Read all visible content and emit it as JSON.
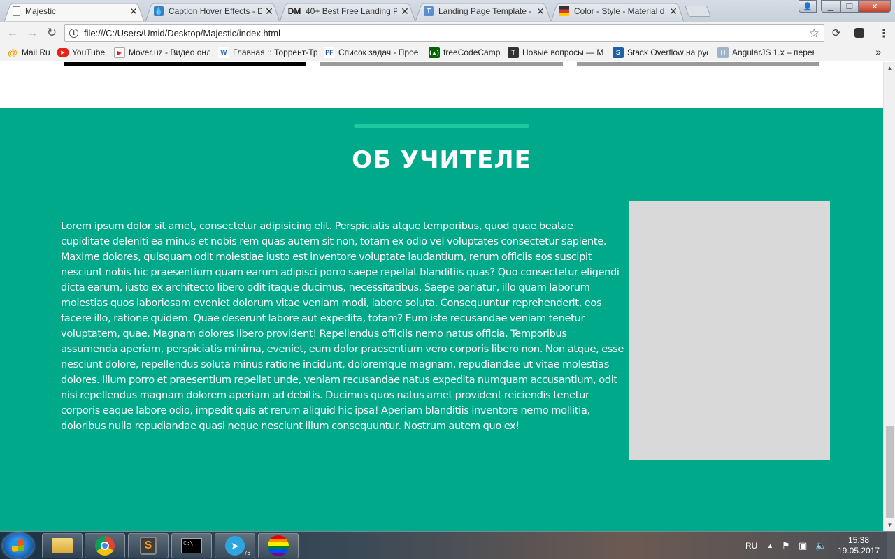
{
  "browser": {
    "tabs": [
      {
        "title": "Majestic",
        "active": true,
        "icon": "page-icon"
      },
      {
        "title": "Caption Hover Effects - D",
        "active": false,
        "icon": "drop-icon"
      },
      {
        "title": "40+ Best Free Landing P",
        "active": false,
        "icon": "dm-icon"
      },
      {
        "title": "Landing Page Template -",
        "active": false,
        "icon": "t-icon"
      },
      {
        "title": "Color - Style - Material d",
        "active": false,
        "icon": "material-icon"
      }
    ],
    "url": "file:///C:/Users/Umid/Desktop/Majestic/index.html",
    "bookmarks": [
      {
        "label": "Mail.Ru",
        "icon": "mailru-icon"
      },
      {
        "label": "YouTube",
        "icon": "youtube-icon"
      },
      {
        "label": "Mover.uz - Видео онл",
        "icon": "mover-icon"
      },
      {
        "label": "Главная :: Торрент-Тр",
        "icon": "torrent-icon"
      },
      {
        "label": "Список задач - Прое",
        "icon": "pf-icon"
      },
      {
        "label": "freeCodeCamp",
        "icon": "freecodecamp-icon"
      },
      {
        "label": "Новые вопросы — М",
        "icon": "toster-icon"
      },
      {
        "label": "Stack Overflow на рус",
        "icon": "stackoverflow-icon"
      },
      {
        "label": "AngularJS 1.x – перев",
        "icon": "angular-icon"
      }
    ]
  },
  "page": {
    "section_title": "ОБ УЧИТЕЛЕ",
    "about_text": "Lorem ipsum dolor sit amet, consectetur adipisicing elit. Perspiciatis atque temporibus, quod quae beatae cupiditate deleniti ea minus et nobis rem quas autem sit non, totam ex odio vel voluptates consectetur sapiente. Maxime dolores, quisquam odit molestiae iusto est inventore voluptate laudantium, rerum officiis eos suscipit nesciunt nobis hic praesentium quam earum adipisci porro saepe repellat blanditiis quas? Quo consectetur eligendi dicta earum, iusto ex architecto libero odit itaque ducimus, necessitatibus. Saepe pariatur, illo quam laborum molestias quos laboriosam eveniet dolorum vitae veniam modi, labore soluta. Consequuntur reprehenderit, eos facere illo, ratione quidem. Quae deserunt labore aut expedita, totam? Eum iste recusandae veniam tenetur voluptatem, quae. Magnam dolores libero provident! Repellendus officiis nemo natus officia. Temporibus assumenda aperiam, perspiciatis minima, eveniet, eum dolor praesentium vero corporis libero non. Non atque, esse nesciunt dolore, repellendus soluta minus ratione incidunt, doloremque magnam, repudiandae ut vitae molestias dolores. Illum porro et praesentium repellat unde, veniam recusandae natus expedita numquam accusantium, odit nisi repellendus magnam dolorem aperiam ad debitis. Ducimus quos natus amet provident reiciendis tenetur corporis eaque labore odio, impedit quis at rerum aliquid hic ipsa! Aperiam blanditiis inventore nemo mollitia, doloribus nulla repudiandae quasi neque nesciunt illum consequuntur. Nostrum autem quo ex!",
    "colors": {
      "section_bg": "#00a98a",
      "divider": "#1ec9a0",
      "photo_placeholder": "#d9d9d9"
    }
  },
  "taskbar": {
    "apps": [
      "explorer-icon",
      "chrome-icon",
      "sublime-text-icon",
      "cmd-icon",
      "telegram-icon",
      "lgbt-app-icon"
    ],
    "telegram_badge": "76",
    "language": "RU",
    "time": "15:38",
    "date": "19.05.2017"
  }
}
